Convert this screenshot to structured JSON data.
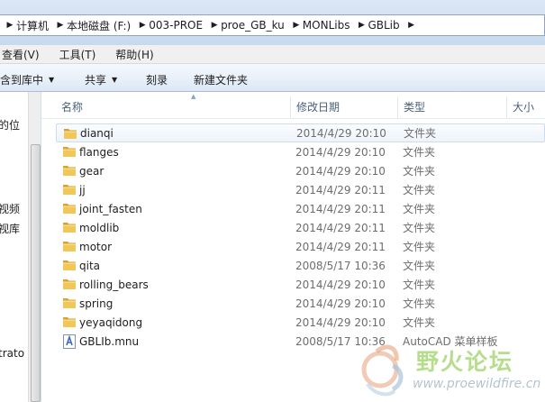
{
  "address": {
    "crumbs": [
      "计算机",
      "本地磁盘 (F:)",
      "003-PROE",
      "proe_GB_ku",
      "MONLibs",
      "GBLib"
    ],
    "separator": "▶"
  },
  "menu": {
    "items": [
      "查看(V)",
      "工具(T)",
      "帮助(H)"
    ]
  },
  "toolbar": {
    "include_library": "包含到库中",
    "share": "共享",
    "burn": "刻录",
    "new_folder": "新建文件夹",
    "caret": "▼"
  },
  "nav": {
    "items": [
      "的位",
      "视频",
      "视库",
      "trato"
    ]
  },
  "columns": {
    "name": "名称",
    "date": "修改日期",
    "type": "类型",
    "size": "大小",
    "sort_arrow": "▲"
  },
  "files": [
    {
      "name": "dianqi",
      "date": "2014/4/29 20:10",
      "type": "文件夹",
      "icon": "folder-icon"
    },
    {
      "name": "flanges",
      "date": "2014/4/29 20:10",
      "type": "文件夹",
      "icon": "folder-icon"
    },
    {
      "name": "gear",
      "date": "2014/4/29 20:10",
      "type": "文件夹",
      "icon": "folder-icon"
    },
    {
      "name": "jj",
      "date": "2014/4/29 20:11",
      "type": "文件夹",
      "icon": "folder-icon"
    },
    {
      "name": "joint_fasten",
      "date": "2014/4/29 20:11",
      "type": "文件夹",
      "icon": "folder-icon"
    },
    {
      "name": "moldlib",
      "date": "2014/4/29 20:11",
      "type": "文件夹",
      "icon": "folder-icon"
    },
    {
      "name": "motor",
      "date": "2014/4/29 20:11",
      "type": "文件夹",
      "icon": "folder-icon"
    },
    {
      "name": "qita",
      "date": "2008/5/17 10:36",
      "type": "文件夹",
      "icon": "folder-icon"
    },
    {
      "name": "rolling_bears",
      "date": "2014/4/29 20:10",
      "type": "文件夹",
      "icon": "folder-icon"
    },
    {
      "name": "spring",
      "date": "2014/4/29 20:10",
      "type": "文件夹",
      "icon": "folder-icon"
    },
    {
      "name": "yeyaqidong",
      "date": "2014/4/29 20:10",
      "type": "文件夹",
      "icon": "folder-icon"
    },
    {
      "name": "GBLIb.mnu",
      "date": "2008/5/17 10:36",
      "type": "AutoCAD 菜单样板",
      "icon": "autocad-menu-file-icon"
    }
  ],
  "watermark": {
    "title": "野火论坛",
    "url": "www.proewildfire.cn"
  },
  "colors": {
    "folder": "#e8b73a",
    "selection_border": "#cddcef",
    "watermark_green": "#b6dd8c"
  }
}
